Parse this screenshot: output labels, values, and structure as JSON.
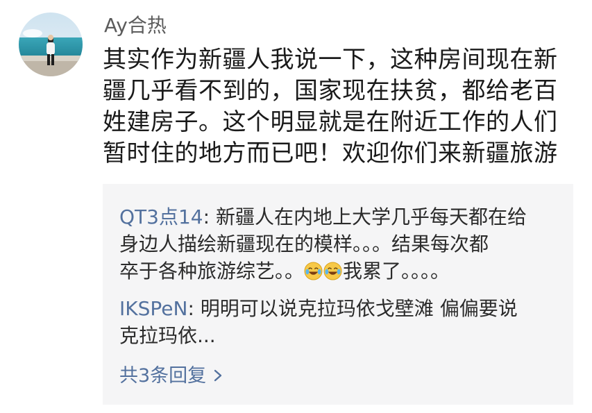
{
  "comment": {
    "username": "Ay合热",
    "avatar_icon": "avatar-photo-icon",
    "text_lines": [
      "其实作为新疆人我说一下，这种房间现在新",
      "疆几乎看不到的，国家现在扶贫，都给老百",
      "姓建房子。这个明显就是在附近工作的人们",
      "暂时住的地方而已吧！欢迎你们来新疆旅游"
    ]
  },
  "replies": {
    "items": [
      {
        "author": "QT3点14",
        "separator": ": ",
        "lines": [
          "新疆人在内地上大学几乎每天都在给",
          "身边人描绘新疆现在的模样。。。结果每次都",
          "卒于各种旅游综艺。。",
          "我累了。。。。"
        ],
        "emoji_icon": "laughing-crying-emoji-icon"
      },
      {
        "author": "IKSPeN",
        "separator": ": ",
        "lines": [
          "明明可以说克拉玛依戈壁滩 偏偏要说",
          "克拉玛依..."
        ]
      }
    ],
    "more_label": "共3条回复",
    "more_icon": "chevron-right-icon"
  },
  "colors": {
    "link": "#53719e",
    "text": "#1a1a1a",
    "username": "#5c5c5c",
    "reply_background": "#f5f5f6"
  }
}
